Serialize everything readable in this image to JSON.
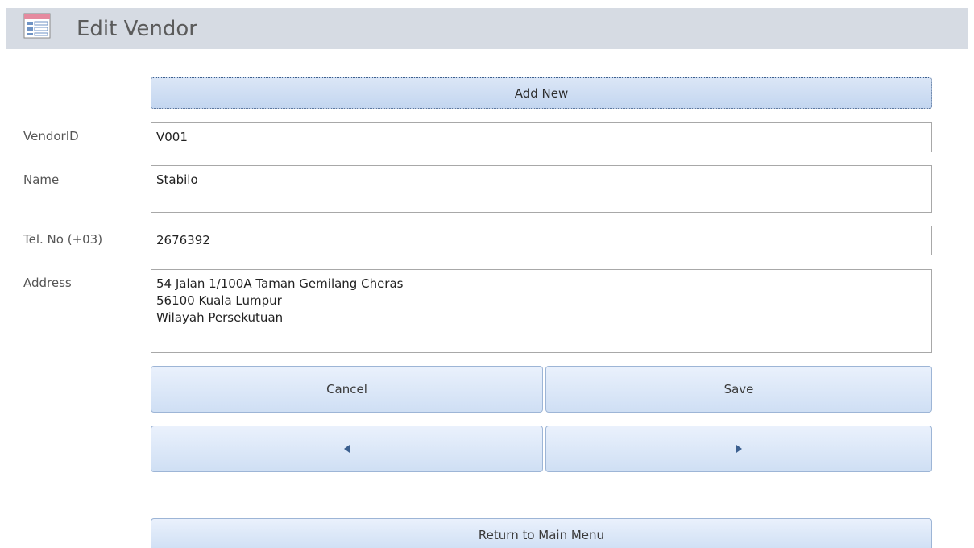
{
  "header": {
    "title": "Edit Vendor",
    "icon": "form-icon"
  },
  "toolbar": {
    "add_new_label": "Add New"
  },
  "fields": {
    "vendor_id": {
      "label": "VendorID",
      "value": "V001"
    },
    "name": {
      "label": "Name",
      "value": "Stabilo"
    },
    "tel": {
      "label": "Tel. No (+03)",
      "value": "2676392"
    },
    "address": {
      "label": "Address",
      "value": "54 Jalan 1/100A Taman Gemilang Cheras\n56100 Kuala Lumpur\nWilayah Persekutuan"
    }
  },
  "actions": {
    "cancel_label": "Cancel",
    "save_label": "Save",
    "prev_icon": "triangle-left-icon",
    "next_icon": "triangle-right-icon",
    "return_label": "Return to Main Menu"
  },
  "colors": {
    "header_bg": "#d6dbe3",
    "button_top": "#eaf1fc",
    "button_bottom": "#cfdff4",
    "button_border": "#9db5d6",
    "arrow": "#3b5f8f"
  }
}
